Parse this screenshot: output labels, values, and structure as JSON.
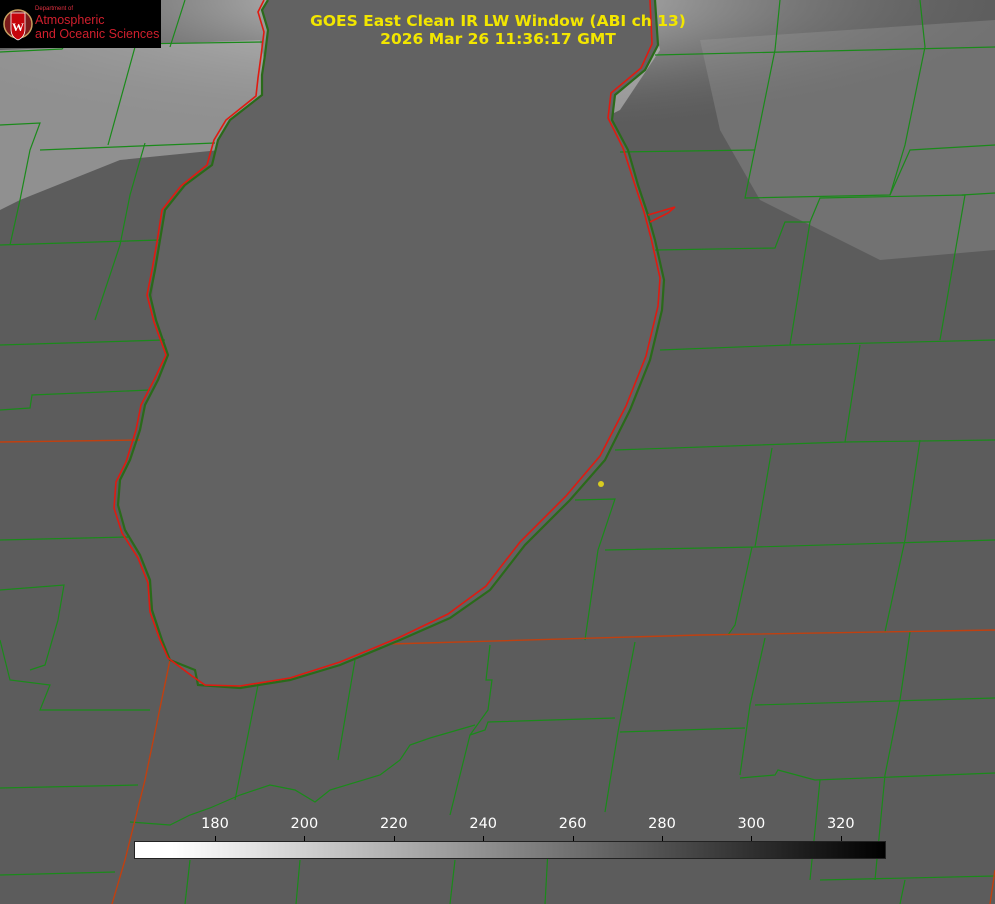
{
  "title": {
    "line1": "GOES East Clean IR LW Window (ABI ch 13)",
    "line2": "2026 Mar 26 11:36:17 GMT"
  },
  "logo": {
    "dept": "Department of",
    "line1": "Atmospheric",
    "line2": "and Oceanic Sciences",
    "shield_letter": "W"
  },
  "colorbar": {
    "ticks": [
      "180",
      "200",
      "220",
      "240",
      "260",
      "280",
      "300",
      "320"
    ]
  },
  "colors": {
    "title": "#f2e600",
    "lake_outline": "#e01a10",
    "county_lines": "#1a8a1a",
    "state_lines": "#c04010",
    "marker": "#d8cc20"
  },
  "map_marker": {
    "icon": "station-dot-icon"
  }
}
